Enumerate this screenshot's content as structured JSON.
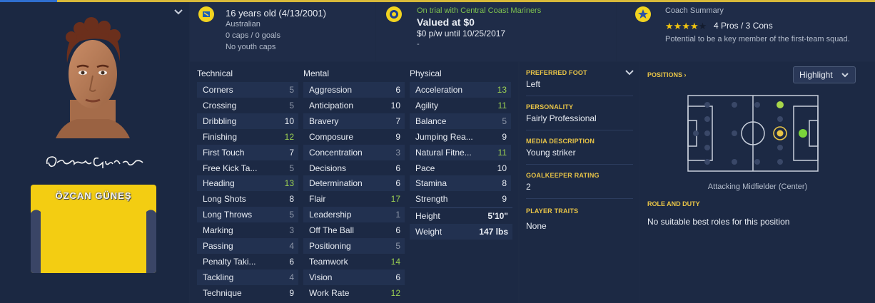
{
  "player": {
    "shirt_name": "ÖZCAN GÜNEŞ"
  },
  "header": {
    "age": "16 years old (4/13/2001)",
    "nationality": "Australian",
    "caps": "0 caps / 0 goals",
    "youth_caps": "No youth caps",
    "trial": "On trial with Central Coast Mariners",
    "value": "Valued at $0",
    "wage": "$0 p/w until 10/25/2017",
    "dash": "-",
    "coach_title": "Coach Summary",
    "stars": 4,
    "stars_max": 5,
    "pros_cons": "4 Pros / 3 Cons",
    "potential": "Potential to be a key member of the first-team squad."
  },
  "technical": {
    "title": "Technical",
    "items": [
      {
        "label": "Corners",
        "value": "5"
      },
      {
        "label": "Crossing",
        "value": "5"
      },
      {
        "label": "Dribbling",
        "value": "10"
      },
      {
        "label": "Finishing",
        "value": "12"
      },
      {
        "label": "First Touch",
        "value": "7"
      },
      {
        "label": "Free Kick Ta...",
        "value": "5"
      },
      {
        "label": "Heading",
        "value": "13"
      },
      {
        "label": "Long Shots",
        "value": "8"
      },
      {
        "label": "Long Throws",
        "value": "5"
      },
      {
        "label": "Marking",
        "value": "3"
      },
      {
        "label": "Passing",
        "value": "4"
      },
      {
        "label": "Penalty Taki...",
        "value": "6"
      },
      {
        "label": "Tackling",
        "value": "4"
      },
      {
        "label": "Technique",
        "value": "9"
      }
    ]
  },
  "mental": {
    "title": "Mental",
    "items": [
      {
        "label": "Aggression",
        "value": "6"
      },
      {
        "label": "Anticipation",
        "value": "10"
      },
      {
        "label": "Bravery",
        "value": "7"
      },
      {
        "label": "Composure",
        "value": "9"
      },
      {
        "label": "Concentration",
        "value": "3"
      },
      {
        "label": "Decisions",
        "value": "6"
      },
      {
        "label": "Determination",
        "value": "6"
      },
      {
        "label": "Flair",
        "value": "17"
      },
      {
        "label": "Leadership",
        "value": "1"
      },
      {
        "label": "Off The Ball",
        "value": "6"
      },
      {
        "label": "Positioning",
        "value": "5"
      },
      {
        "label": "Teamwork",
        "value": "14"
      },
      {
        "label": "Vision",
        "value": "6"
      },
      {
        "label": "Work Rate",
        "value": "12"
      }
    ]
  },
  "physical": {
    "title": "Physical",
    "items": [
      {
        "label": "Acceleration",
        "value": "13"
      },
      {
        "label": "Agility",
        "value": "11"
      },
      {
        "label": "Balance",
        "value": "5"
      },
      {
        "label": "Jumping Rea...",
        "value": "9"
      },
      {
        "label": "Natural Fitne...",
        "value": "11"
      },
      {
        "label": "Pace",
        "value": "10"
      },
      {
        "label": "Stamina",
        "value": "8"
      },
      {
        "label": "Strength",
        "value": "9"
      }
    ],
    "height_label": "Height",
    "height_value": "5'10\"",
    "weight_label": "Weight",
    "weight_value": "147 lbs"
  },
  "info": {
    "foot_label": "PREFERRED FOOT",
    "foot_value": "Left",
    "personality_label": "PERSONALITY",
    "personality_value": "Fairly Professional",
    "media_label": "MEDIA DESCRIPTION",
    "media_value": "Young striker",
    "gk_label": "GOALKEEPER RATING",
    "gk_value": "2",
    "traits_label": "PLAYER TRAITS",
    "traits_value": "None"
  },
  "positions": {
    "title": "POSITIONS",
    "dropdown": "Highlight",
    "position_name": "Attacking Midfielder (Center)",
    "role_label": "ROLE AND DUTY",
    "role_value": "No suitable best roles for this position"
  },
  "colors": {
    "highlight_attr": "#9bd052",
    "gold": "#e8c447",
    "badge": "#f1d320"
  }
}
